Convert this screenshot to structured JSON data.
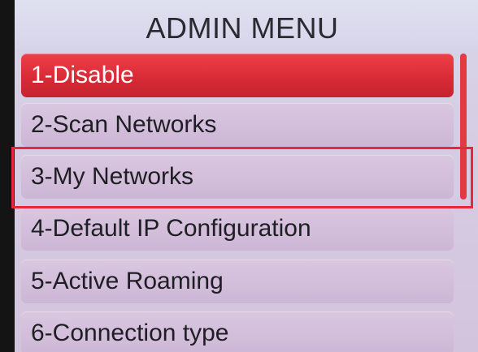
{
  "header": {
    "title": "ADMIN MENU"
  },
  "menu": {
    "items": [
      {
        "label": "1-Disable",
        "selected": true
      },
      {
        "label": "2-Scan Networks",
        "selected": false
      },
      {
        "label": "3-My Networks",
        "selected": false
      },
      {
        "label": "4-Default IP Configuration",
        "selected": false
      },
      {
        "label": "5-Active Roaming",
        "selected": false
      },
      {
        "label": "6-Connection type",
        "selected": false
      }
    ]
  },
  "colors": {
    "selected_item": "#d82b36",
    "menu_item": "#d3bddb",
    "header": "#dcdcee",
    "highlight_outline": "#e8283a"
  }
}
